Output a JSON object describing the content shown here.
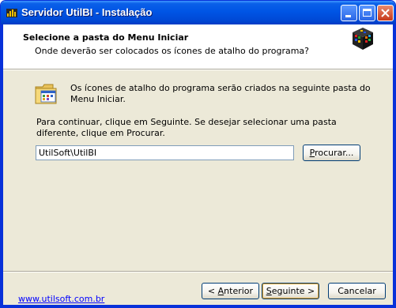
{
  "window": {
    "title": "Servidor UtilBI - Instalação"
  },
  "header": {
    "title": "Selecione a pasta do Menu Iniciar",
    "subtitle": "Onde deverão ser colocados os ícones de atalho do programa?"
  },
  "body": {
    "info": "Os ícones de atalho do programa serão criados na seguinte pasta do Menu Iniciar.",
    "instructions": "Para continuar, clique em Seguinte. Se desejar selecionar uma pasta diferente, clique em Procurar.",
    "folder_path": "UtilSoft\\UtilBI",
    "browse_prefix": "",
    "browse_accel": "P",
    "browse_rest": "rocurar..."
  },
  "footer": {
    "link": "www.utilsoft.com.br",
    "back_prefix": "< ",
    "back_accel": "A",
    "back_rest": "nterior",
    "next_accel": "S",
    "next_rest": "eguinte >",
    "cancel": "Cancelar"
  },
  "colors": {
    "title_bar": "#0055E5",
    "face": "#ECE9D8",
    "link": "#0000FF"
  },
  "icons": [
    "app-icon",
    "minimize-icon",
    "maximize-icon",
    "close-icon",
    "installer-cube-icon",
    "start-menu-folder-icon"
  ]
}
